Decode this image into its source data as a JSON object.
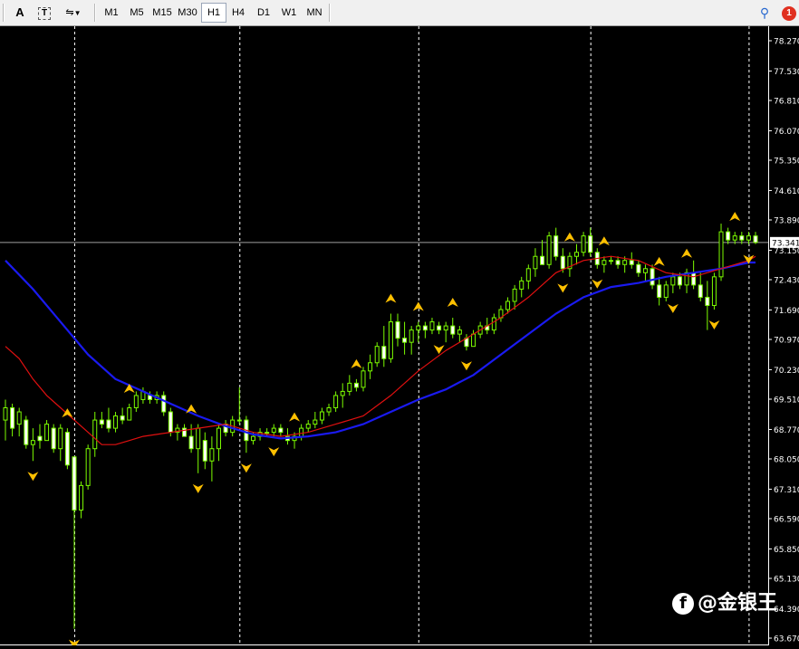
{
  "toolbar": {
    "tools": [
      {
        "name": "text-tool",
        "label": "A"
      },
      {
        "name": "text-label-tool",
        "label": "T"
      },
      {
        "name": "arrows-tool",
        "label": "⇋"
      }
    ],
    "timeframes": [
      "M1",
      "M5",
      "M15",
      "M30",
      "H1",
      "H4",
      "D1",
      "W1",
      "MN"
    ],
    "active_timeframe": "H1",
    "notification_count": "1"
  },
  "watermark": {
    "text": "@金银王",
    "logo": "f"
  },
  "colors": {
    "background": "#000000",
    "bull": "#7CFC00",
    "bear": "#FFFFFF",
    "ma_fast": "#E01010",
    "ma_slow": "#1A1AF0",
    "fractal": "#FFC000",
    "grid": "#FFFFFF",
    "price_line": "#A0A0A0"
  },
  "chart_data": {
    "type": "candlestick",
    "y_axis_labels": [
      "78.270",
      "77.530",
      "76.810",
      "76.070",
      "75.350",
      "74.610",
      "73.890",
      "73.150",
      "72.430",
      "71.690",
      "70.970",
      "70.230",
      "69.510",
      "68.770",
      "68.050",
      "67.310",
      "66.590",
      "65.850",
      "65.130",
      "64.390",
      "63.670"
    ],
    "ylim": [
      63.67,
      78.27
    ],
    "current_price": "73.341",
    "candle_count": 110,
    "candles": [
      [
        69.0,
        69.5,
        68.5,
        69.3
      ],
      [
        69.3,
        69.4,
        68.6,
        68.8
      ],
      [
        68.9,
        69.3,
        68.6,
        69.2
      ],
      [
        69.0,
        69.1,
        68.3,
        68.4
      ],
      [
        68.4,
        68.8,
        68.0,
        68.5
      ],
      [
        68.6,
        68.9,
        68.3,
        68.5
      ],
      [
        68.5,
        69.0,
        68.5,
        68.9
      ],
      [
        68.8,
        68.9,
        68.2,
        68.3
      ],
      [
        68.3,
        68.9,
        68.0,
        68.8
      ],
      [
        68.7,
        68.8,
        67.8,
        67.9
      ],
      [
        68.1,
        68.1,
        63.9,
        66.8
      ],
      [
        66.8,
        67.5,
        66.6,
        67.4
      ],
      [
        67.4,
        68.4,
        67.3,
        68.3
      ],
      [
        68.3,
        69.2,
        68.1,
        69.0
      ],
      [
        69.0,
        69.2,
        68.8,
        68.9
      ],
      [
        69.0,
        69.3,
        68.7,
        68.8
      ],
      [
        68.8,
        69.2,
        68.7,
        69.1
      ],
      [
        69.1,
        69.3,
        68.9,
        69.0
      ],
      [
        69.0,
        69.4,
        69.0,
        69.3
      ],
      [
        69.3,
        69.7,
        69.2,
        69.6
      ],
      [
        69.5,
        69.8,
        69.4,
        69.7
      ],
      [
        69.6,
        69.7,
        69.4,
        69.5
      ],
      [
        69.5,
        69.7,
        69.4,
        69.6
      ],
      [
        69.6,
        69.7,
        69.1,
        69.2
      ],
      [
        69.2,
        69.3,
        68.6,
        68.7
      ],
      [
        68.7,
        68.9,
        68.5,
        68.8
      ],
      [
        68.8,
        68.9,
        68.6,
        68.6
      ],
      [
        68.6,
        68.9,
        68.2,
        68.3
      ],
      [
        68.3,
        68.9,
        67.7,
        68.8
      ],
      [
        68.5,
        68.7,
        67.8,
        68.0
      ],
      [
        68.0,
        68.6,
        67.5,
        68.3
      ],
      [
        68.3,
        68.9,
        68.0,
        68.8
      ],
      [
        68.9,
        69.0,
        68.6,
        68.7
      ],
      [
        68.7,
        69.1,
        68.6,
        69.0
      ],
      [
        69.0,
        69.8,
        68.9,
        69.0
      ],
      [
        69.0,
        69.1,
        68.2,
        68.5
      ],
      [
        68.5,
        68.7,
        68.4,
        68.6
      ],
      [
        68.6,
        68.8,
        68.5,
        68.7
      ],
      [
        68.7,
        68.8,
        68.6,
        68.7
      ],
      [
        68.7,
        68.9,
        68.6,
        68.8
      ],
      [
        68.8,
        68.9,
        68.6,
        68.7
      ],
      [
        68.6,
        68.8,
        68.4,
        68.5
      ],
      [
        68.5,
        68.7,
        68.3,
        68.6
      ],
      [
        68.6,
        68.9,
        68.5,
        68.8
      ],
      [
        68.8,
        69.0,
        68.7,
        68.9
      ],
      [
        68.9,
        69.2,
        68.8,
        69.0
      ],
      [
        69.0,
        69.3,
        68.9,
        69.2
      ],
      [
        69.2,
        69.4,
        69.1,
        69.3
      ],
      [
        69.3,
        69.7,
        69.2,
        69.6
      ],
      [
        69.6,
        69.9,
        69.3,
        69.7
      ],
      [
        69.7,
        70.1,
        69.6,
        69.9
      ],
      [
        69.9,
        70.0,
        69.7,
        69.8
      ],
      [
        69.8,
        70.3,
        69.7,
        70.2
      ],
      [
        70.2,
        70.6,
        70.0,
        70.4
      ],
      [
        70.4,
        70.9,
        70.3,
        70.8
      ],
      [
        70.8,
        71.3,
        70.3,
        70.5
      ],
      [
        70.5,
        71.6,
        70.4,
        71.4
      ],
      [
        71.4,
        71.6,
        70.8,
        71.0
      ],
      [
        71.0,
        71.4,
        70.6,
        70.9
      ],
      [
        70.9,
        71.3,
        70.6,
        71.2
      ],
      [
        71.2,
        71.4,
        70.9,
        71.3
      ],
      [
        71.3,
        71.4,
        71.0,
        71.2
      ],
      [
        71.2,
        71.5,
        71.1,
        71.4
      ],
      [
        71.3,
        71.4,
        71.1,
        71.2
      ],
      [
        71.2,
        71.4,
        70.9,
        71.3
      ],
      [
        71.3,
        71.5,
        71.0,
        71.1
      ],
      [
        71.1,
        71.3,
        70.9,
        71.2
      ],
      [
        71.0,
        71.1,
        70.7,
        70.8
      ],
      [
        70.8,
        71.2,
        70.8,
        71.1
      ],
      [
        71.1,
        71.4,
        71.0,
        71.3
      ],
      [
        71.3,
        71.5,
        71.1,
        71.2
      ],
      [
        71.2,
        71.6,
        71.1,
        71.5
      ],
      [
        71.5,
        71.8,
        71.4,
        71.7
      ],
      [
        71.7,
        72.0,
        71.6,
        71.9
      ],
      [
        71.9,
        72.3,
        71.7,
        72.2
      ],
      [
        72.2,
        72.5,
        72.0,
        72.4
      ],
      [
        72.4,
        72.8,
        72.2,
        72.7
      ],
      [
        72.7,
        73.2,
        72.5,
        73.0
      ],
      [
        73.0,
        73.4,
        72.8,
        72.8
      ],
      [
        72.8,
        73.6,
        72.7,
        73.5
      ],
      [
        73.5,
        73.7,
        72.9,
        73.0
      ],
      [
        73.0,
        73.2,
        72.6,
        72.7
      ],
      [
        72.7,
        73.1,
        72.5,
        73.0
      ],
      [
        73.0,
        73.3,
        72.8,
        73.1
      ],
      [
        73.1,
        73.6,
        73.0,
        73.5
      ],
      [
        73.5,
        73.7,
        73.0,
        73.1
      ],
      [
        73.1,
        73.2,
        72.7,
        72.8
      ],
      [
        72.8,
        73.0,
        72.6,
        72.9
      ],
      [
        72.9,
        73.0,
        72.8,
        72.9
      ],
      [
        72.9,
        73.0,
        72.7,
        72.8
      ],
      [
        72.8,
        73.0,
        72.6,
        72.9
      ],
      [
        72.9,
        73.1,
        72.7,
        72.8
      ],
      [
        72.8,
        72.9,
        72.5,
        72.6
      ],
      [
        72.6,
        72.8,
        72.4,
        72.7
      ],
      [
        72.7,
        72.8,
        72.2,
        72.3
      ],
      [
        72.3,
        72.5,
        71.8,
        72.0
      ],
      [
        72.0,
        72.4,
        71.9,
        72.3
      ],
      [
        72.3,
        72.6,
        72.1,
        72.5
      ],
      [
        72.5,
        72.6,
        72.2,
        72.3
      ],
      [
        72.3,
        72.7,
        72.1,
        72.6
      ],
      [
        72.6,
        72.9,
        72.2,
        72.3
      ],
      [
        72.3,
        72.6,
        71.9,
        72.0
      ],
      [
        72.0,
        72.4,
        71.2,
        71.8
      ],
      [
        71.8,
        72.6,
        71.7,
        72.5
      ],
      [
        72.5,
        73.8,
        72.4,
        73.6
      ],
      [
        73.6,
        73.7,
        73.3,
        73.4
      ],
      [
        73.4,
        73.6,
        73.3,
        73.5
      ],
      [
        73.5,
        73.6,
        73.3,
        73.4
      ],
      [
        73.4,
        73.6,
        73.3,
        73.5
      ],
      [
        73.5,
        73.6,
        73.3,
        73.34
      ]
    ],
    "ma_fast": [
      [
        0,
        70.8
      ],
      [
        2,
        70.5
      ],
      [
        4,
        70.0
      ],
      [
        6,
        69.6
      ],
      [
        8,
        69.3
      ],
      [
        10,
        69.0
      ],
      [
        12,
        68.7
      ],
      [
        14,
        68.4
      ],
      [
        16,
        68.4
      ],
      [
        18,
        68.5
      ],
      [
        20,
        68.6
      ],
      [
        24,
        68.7
      ],
      [
        28,
        68.8
      ],
      [
        32,
        68.9
      ],
      [
        36,
        68.7
      ],
      [
        40,
        68.6
      ],
      [
        44,
        68.7
      ],
      [
        48,
        68.9
      ],
      [
        52,
        69.1
      ],
      [
        56,
        69.6
      ],
      [
        60,
        70.2
      ],
      [
        64,
        70.7
      ],
      [
        68,
        71.1
      ],
      [
        72,
        71.5
      ],
      [
        76,
        72.0
      ],
      [
        80,
        72.6
      ],
      [
        84,
        72.9
      ],
      [
        88,
        73.0
      ],
      [
        92,
        72.9
      ],
      [
        96,
        72.6
      ],
      [
        100,
        72.5
      ],
      [
        104,
        72.7
      ],
      [
        108,
        72.9
      ],
      [
        109,
        73.0
      ]
    ],
    "ma_slow": [
      [
        0,
        72.9
      ],
      [
        4,
        72.2
      ],
      [
        8,
        71.4
      ],
      [
        12,
        70.6
      ],
      [
        16,
        70.0
      ],
      [
        20,
        69.7
      ],
      [
        24,
        69.4
      ],
      [
        28,
        69.1
      ],
      [
        32,
        68.85
      ],
      [
        36,
        68.65
      ],
      [
        40,
        68.55
      ],
      [
        44,
        68.6
      ],
      [
        48,
        68.7
      ],
      [
        52,
        68.9
      ],
      [
        56,
        69.2
      ],
      [
        60,
        69.5
      ],
      [
        64,
        69.75
      ],
      [
        68,
        70.1
      ],
      [
        72,
        70.6
      ],
      [
        76,
        71.1
      ],
      [
        80,
        71.6
      ],
      [
        84,
        72.0
      ],
      [
        88,
        72.25
      ],
      [
        92,
        72.35
      ],
      [
        96,
        72.5
      ],
      [
        100,
        72.6
      ],
      [
        104,
        72.7
      ],
      [
        108,
        72.85
      ],
      [
        109,
        72.85
      ]
    ],
    "fractals_up": [
      9,
      18,
      27,
      42,
      51,
      56,
      60,
      65,
      82,
      87,
      95,
      99,
      106
    ],
    "fractals_down": [
      4,
      10,
      28,
      35,
      39,
      63,
      67,
      81,
      86,
      97,
      103,
      108
    ],
    "period_separators": [
      10,
      34,
      60,
      85,
      108
    ]
  }
}
